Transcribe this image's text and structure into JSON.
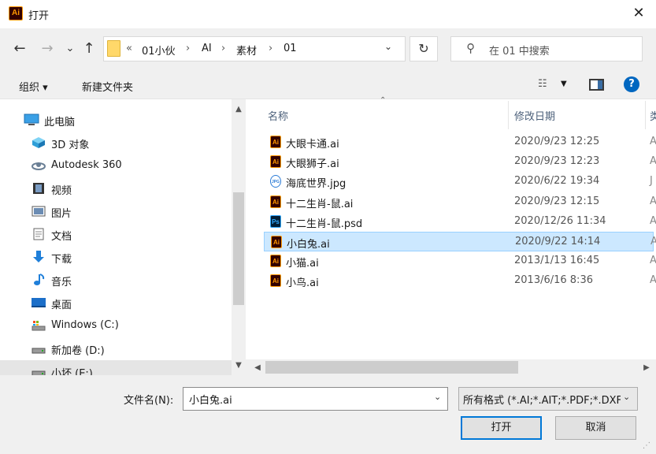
{
  "window": {
    "title": "打开",
    "app_icon": "Ai",
    "close_label": "✕"
  },
  "nav": {
    "back": "←",
    "forward": "→",
    "recent": "⌄",
    "up": "↑",
    "breadcrumb": [
      "«",
      "01小伙",
      "›",
      "AI",
      "›",
      "素材",
      "›",
      "01"
    ],
    "refresh": "↻",
    "search_placeholder": "在 01 中搜索"
  },
  "toolbar": {
    "organize": "组织 ▾",
    "new_folder": "新建文件夹",
    "help": "?"
  },
  "sidebar": {
    "items": [
      {
        "label": "此电脑",
        "icon": "computer-icon"
      },
      {
        "label": "3D 对象",
        "icon": "cube-icon"
      },
      {
        "label": "Autodesk 360",
        "icon": "cloud-icon"
      },
      {
        "label": "视频",
        "icon": "video-icon"
      },
      {
        "label": "图片",
        "icon": "picture-icon"
      },
      {
        "label": "文档",
        "icon": "document-icon"
      },
      {
        "label": "下载",
        "icon": "download-icon"
      },
      {
        "label": "音乐",
        "icon": "music-icon"
      },
      {
        "label": "桌面",
        "icon": "desktop-icon"
      },
      {
        "label": "Windows (C:)",
        "icon": "drive-icon"
      },
      {
        "label": "新加卷 (D:)",
        "icon": "drive-icon"
      },
      {
        "label": "小坏 (E:)",
        "icon": "drive-icon"
      }
    ]
  },
  "columns": {
    "name": "名称",
    "modified": "修改日期",
    "extra": "类"
  },
  "files": [
    {
      "name": "大眼卡通.ai",
      "type": "ai",
      "date": "2020/9/23 12:25",
      "extra": "A"
    },
    {
      "name": "大眼狮子.ai",
      "type": "ai",
      "date": "2020/9/23 12:23",
      "extra": "A"
    },
    {
      "name": "海底世界.jpg",
      "type": "jpg",
      "date": "2020/6/22 19:34",
      "extra": "J"
    },
    {
      "name": "十二生肖-鼠.ai",
      "type": "ai",
      "date": "2020/9/23 12:15",
      "extra": "A"
    },
    {
      "name": "十二生肖-鼠.psd",
      "type": "psd",
      "date": "2020/12/26 11:34",
      "extra": "A"
    },
    {
      "name": "小白兔.ai",
      "type": "ai",
      "date": "2020/9/22 14:14",
      "extra": "A",
      "selected": true
    },
    {
      "name": "小猫.ai",
      "type": "ai",
      "date": "2013/1/13 16:45",
      "extra": "A"
    },
    {
      "name": "小鸟.ai",
      "type": "ai",
      "date": "2013/6/16 8:36",
      "extra": "A"
    }
  ],
  "footer": {
    "filename_label": "文件名(N):",
    "filename_value": "小白兔.ai",
    "filetype_value": "所有格式 (*.AI;*.AIT;*.PDF;*.DXF",
    "open_button": "打开",
    "cancel_button": "取消"
  },
  "colors": {
    "selection": "#cce8ff",
    "accent": "#0078d7",
    "ai_icon": "#ff9a00",
    "psd_icon": "#31a8ff"
  }
}
